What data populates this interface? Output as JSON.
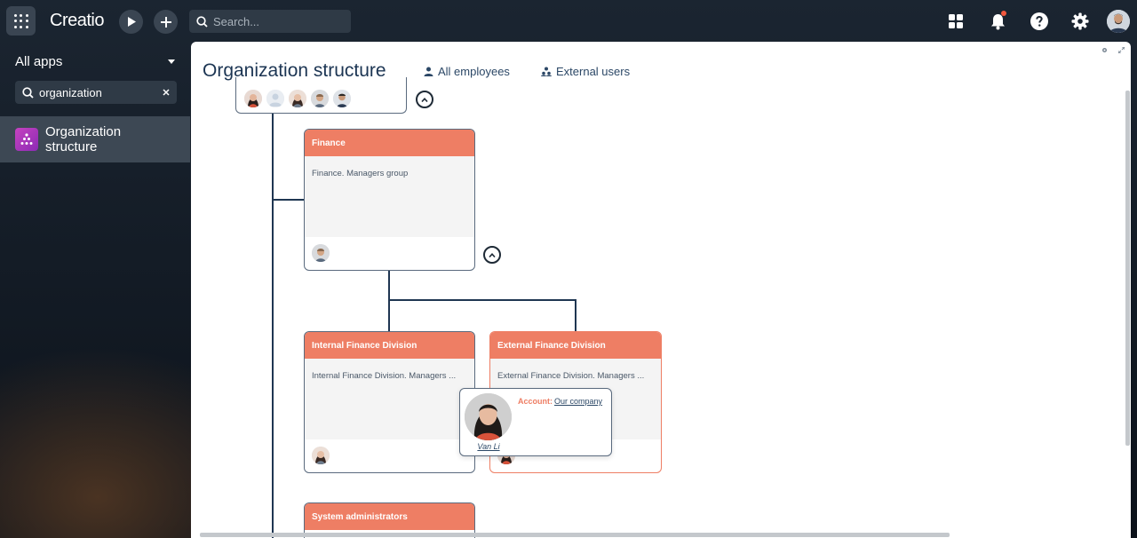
{
  "topbar": {
    "logo": "Creatio",
    "search_placeholder": "Search..."
  },
  "sidebar": {
    "all_apps": "All apps",
    "filter_value": "organization",
    "items": [
      {
        "label": "Organization structure"
      }
    ]
  },
  "page": {
    "title": "Organization structure",
    "links": [
      "All employees",
      "External users"
    ]
  },
  "org": {
    "nodes": [
      {
        "name": "Finance",
        "description": "Finance. Managers group"
      },
      {
        "name": "Internal Finance Division",
        "description": "Internal Finance Division. Managers ..."
      },
      {
        "name": "External Finance Division",
        "description": "External Finance Division. Managers ..."
      },
      {
        "name": "System administrators",
        "description": ""
      }
    ]
  },
  "popup": {
    "name": "Van Li",
    "account_label": "Account:",
    "account_value": "Our company"
  },
  "colors": {
    "accent": "#ee7e64",
    "line": "#1f3652",
    "notification": "#f2583e"
  }
}
